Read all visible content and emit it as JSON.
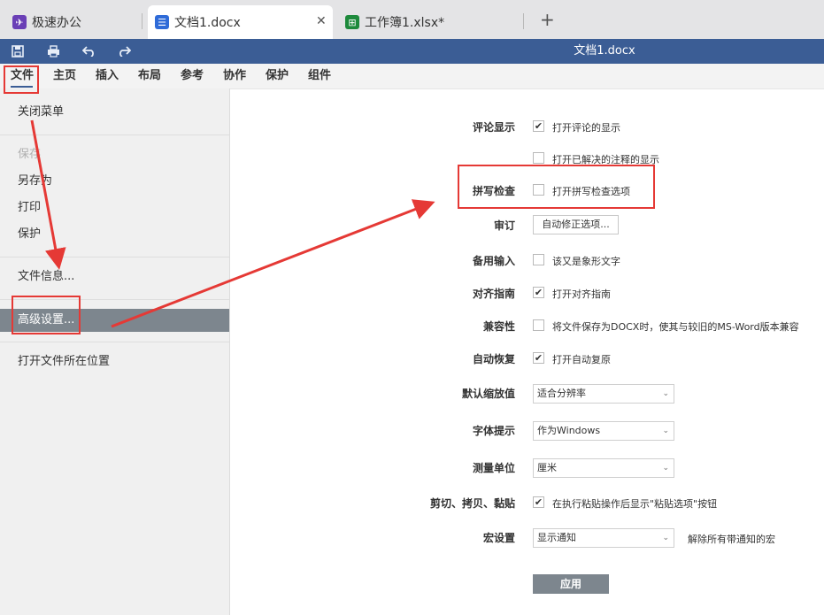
{
  "tabs": [
    {
      "label": "极速办公",
      "icon": "rocket-icon"
    },
    {
      "label": "文档1.docx",
      "icon": "document-icon"
    },
    {
      "label": "工作簿1.xlsx*",
      "icon": "spreadsheet-icon"
    }
  ],
  "titlebar": {
    "title": "文档1.docx"
  },
  "ribbon": [
    "文件",
    "主页",
    "插入",
    "布局",
    "参考",
    "协作",
    "保护",
    "组件"
  ],
  "file_menu": {
    "close": "关闭菜单",
    "save": "保存",
    "save_as": "另存为",
    "print": "打印",
    "protect": "保护",
    "file_info": "文件信息...",
    "advanced": "高级设置...",
    "open_location": "打开文件所在位置"
  },
  "settings": {
    "comments": {
      "label": "评论显示",
      "opt1": "打开评论的显示",
      "opt2": "打开已解决的注释的显示"
    },
    "spell": {
      "label": "拼写检查",
      "opt": "打开拼写检查选项"
    },
    "review": {
      "label": "审订",
      "button": "自动修正选项..."
    },
    "ime": {
      "label": "备用输入",
      "opt": "该又是象形文字"
    },
    "align": {
      "label": "对齐指南",
      "opt": "打开对齐指南"
    },
    "compat": {
      "label": "兼容性",
      "opt": "将文件保存为DOCX时，使其与较旧的MS-Word版本兼容"
    },
    "autorecover": {
      "label": "自动恢复",
      "opt": "打开自动复原"
    },
    "zoom": {
      "label": "默认缩放值",
      "value": "适合分辨率"
    },
    "hinting": {
      "label": "字体提示",
      "value": "作为Windows"
    },
    "unit": {
      "label": "测量单位",
      "value": "厘米"
    },
    "paste": {
      "label": "剪切、拷贝、黏贴",
      "opt": "在执行粘贴操作后显示\"粘贴选项\"按钮"
    },
    "macro": {
      "label": "宏设置",
      "value": "显示通知",
      "hint": "解除所有带通知的宏"
    },
    "apply": "应用"
  },
  "checkbox_states": {
    "comments1": true,
    "comments2": false,
    "spell": false,
    "ime": false,
    "align": true,
    "compat": false,
    "autorecover": true,
    "paste": true
  },
  "colors": {
    "titlebar": "#3b5d95",
    "selected": "#7d868e",
    "annotation": "#e53935"
  }
}
